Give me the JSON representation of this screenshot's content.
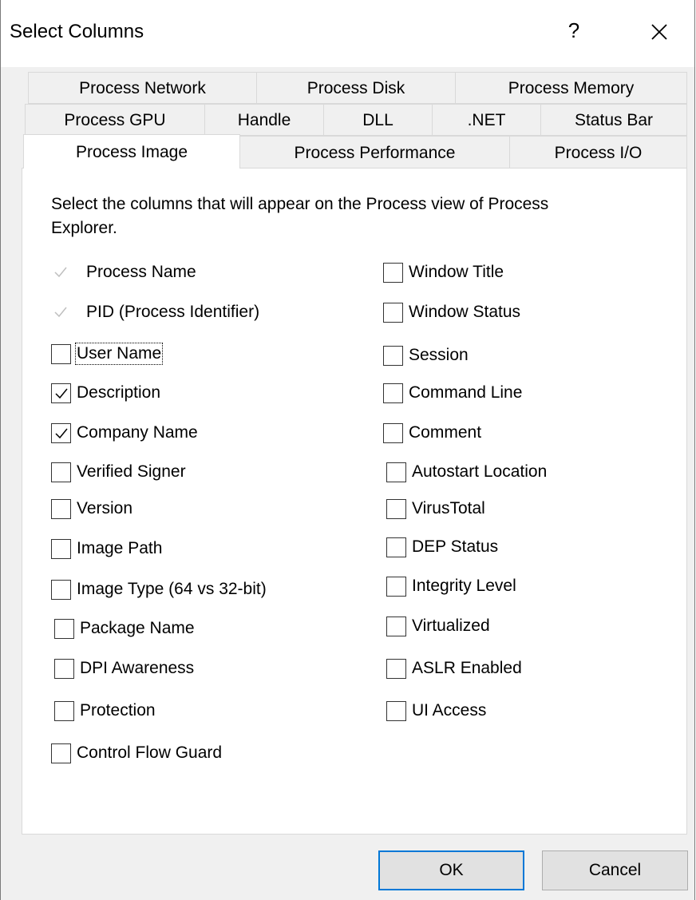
{
  "window": {
    "title": "Select Columns",
    "help_label": "?"
  },
  "tabs": {
    "row1": [
      "Process Network",
      "Process Disk",
      "Process Memory"
    ],
    "row2": [
      "Process GPU",
      "Handle",
      "DLL",
      ".NET",
      "Status Bar"
    ],
    "row3": [
      "Process Image",
      "Process Performance",
      "Process I/O"
    ],
    "active": "Process Image"
  },
  "panel": {
    "instructions": "Select the columns that will appear on the Process view of Process Explorer."
  },
  "left_column": [
    {
      "label": "Process Name",
      "checked": true,
      "disabled": true
    },
    {
      "label": "PID (Process Identifier)",
      "checked": true,
      "disabled": true
    },
    {
      "label": "User Name",
      "checked": false,
      "disabled": false
    },
    {
      "label": "Description",
      "checked": true,
      "disabled": false
    },
    {
      "label": "Company Name",
      "checked": true,
      "disabled": false
    },
    {
      "label": "Verified Signer",
      "checked": false,
      "disabled": false
    },
    {
      "label": "Version",
      "checked": false,
      "disabled": false
    },
    {
      "label": "Image Path",
      "checked": false,
      "disabled": false
    },
    {
      "label": "Image Type (64 vs 32-bit)",
      "checked": false,
      "disabled": false
    },
    {
      "label": "Package Name",
      "checked": false,
      "disabled": false
    },
    {
      "label": "DPI Awareness",
      "checked": false,
      "disabled": false
    },
    {
      "label": "Protection",
      "checked": false,
      "disabled": false
    },
    {
      "label": "Control Flow Guard",
      "checked": false,
      "disabled": false
    }
  ],
  "right_column": [
    {
      "label": "Window Title",
      "checked": false
    },
    {
      "label": "Window Status",
      "checked": false
    },
    {
      "label": "Session",
      "checked": false
    },
    {
      "label": "Command Line",
      "checked": false
    },
    {
      "label": "Comment",
      "checked": false
    },
    {
      "label": "Autostart Location",
      "checked": false
    },
    {
      "label": "VirusTotal",
      "checked": false
    },
    {
      "label": "DEP Status",
      "checked": false
    },
    {
      "label": "Integrity Level",
      "checked": false
    },
    {
      "label": "Virtualized",
      "checked": false
    },
    {
      "label": "ASLR Enabled",
      "checked": false
    },
    {
      "label": "UI Access",
      "checked": false
    }
  ],
  "buttons": {
    "ok": "OK",
    "cancel": "Cancel"
  },
  "colors": {
    "default_button_border": "#0078d7",
    "disabled_check": "#bfbfbf"
  }
}
